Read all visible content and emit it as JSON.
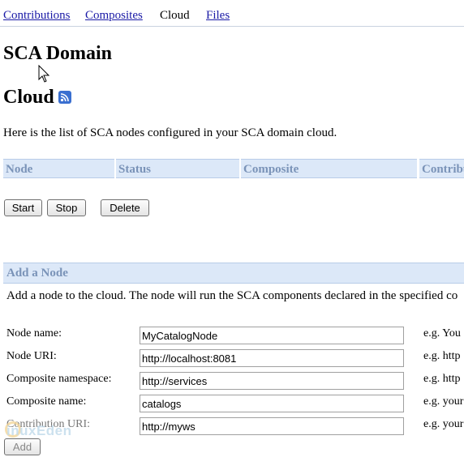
{
  "nav": {
    "contributions": "Contributions",
    "composites": "Composites",
    "cloud": "Cloud",
    "files": "Files"
  },
  "page": {
    "title": "SCA Domain",
    "subtitle": "Cloud",
    "intro": "Here is the list of SCA nodes configured in your SCA domain cloud."
  },
  "table": {
    "columns": [
      "Node",
      "Status",
      "Composite",
      "Contribu"
    ]
  },
  "actions": {
    "start": "Start",
    "stop": "Stop",
    "delete": "Delete"
  },
  "add_node": {
    "heading": "Add a Node",
    "description": "Add a node to the cloud. The node will run the SCA components declared in the specified co",
    "fields": [
      {
        "label": "Node name:",
        "value": "MyCatalogNode",
        "example": "e.g. You"
      },
      {
        "label": "Node URI:",
        "value": "http://localhost:8081",
        "example": "e.g. http"
      },
      {
        "label": "Composite namespace:",
        "value": "http://services",
        "example": "e.g. http"
      },
      {
        "label": "Composite name:",
        "value": "catalogs",
        "example": "e.g. your"
      },
      {
        "label": "Contribution URI:",
        "value": "http://myws",
        "example": "e.g. your"
      }
    ],
    "add_button": "Add"
  },
  "watermark": "inuxEden",
  "icons": {
    "feed": "rss-icon",
    "pointer": "mouse-cursor-icon"
  },
  "colors": {
    "link": "#1a1aa6",
    "header_bg": "#dce8f8",
    "header_text": "#7a93b8"
  }
}
